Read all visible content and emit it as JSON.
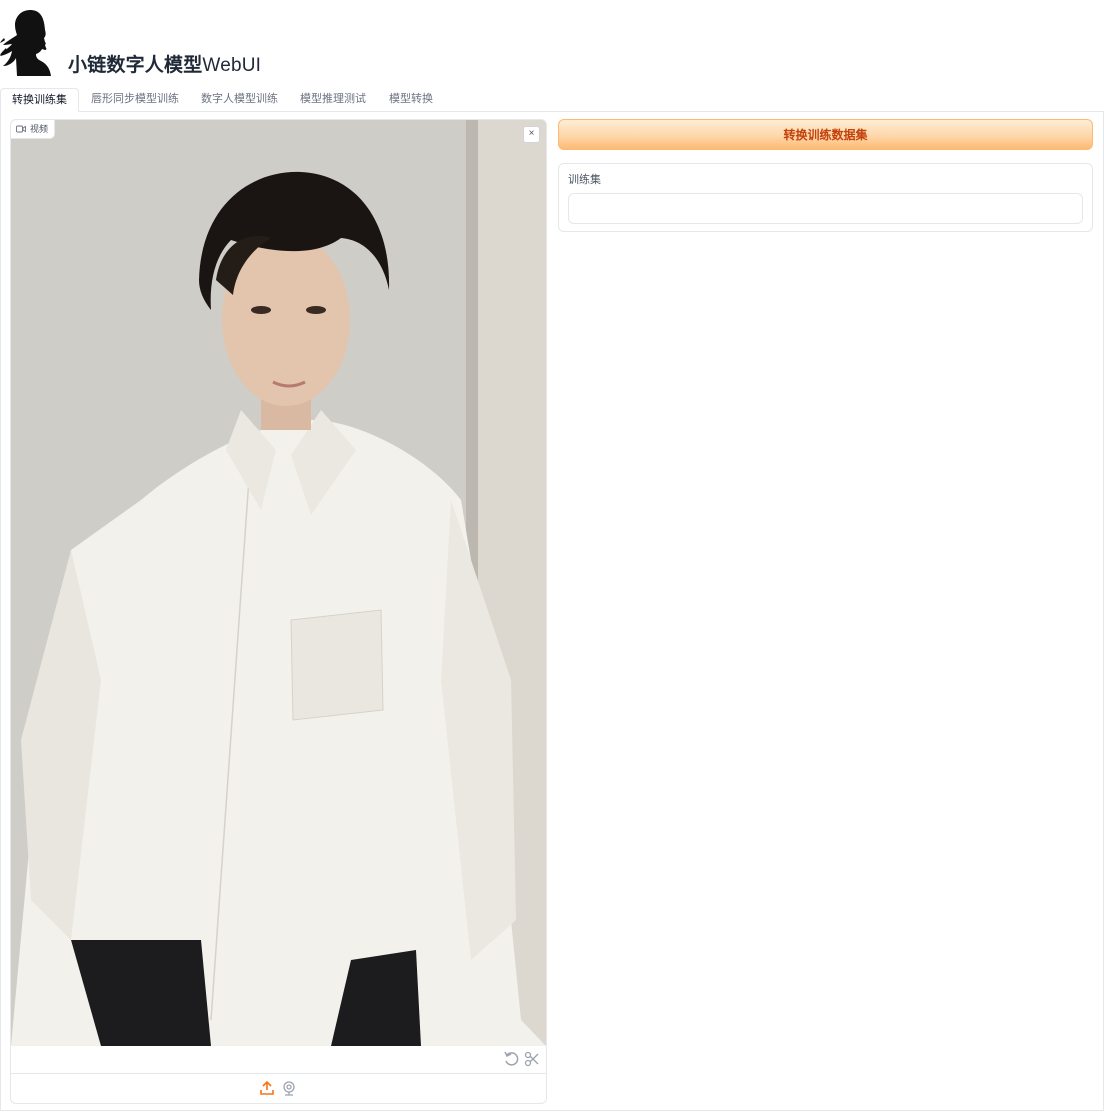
{
  "app": {
    "title_cn": "小链数字人模型",
    "title_en": "WebUI",
    "logo_icon": "woman-silhouette-icon"
  },
  "tabs": [
    {
      "label": "转换训练集",
      "selected": true
    },
    {
      "label": "唇形同步模型训练",
      "selected": false
    },
    {
      "label": "数字人模型训练",
      "selected": false
    },
    {
      "label": "模型推理测试",
      "selected": false
    },
    {
      "label": "模型转换",
      "selected": false
    }
  ],
  "video": {
    "label": "视频",
    "label_icon": "video-camera-icon",
    "clear_icon": "close-icon",
    "clear_symbol": "×",
    "edit_tools": [
      "undo-icon",
      "scissors-icon"
    ],
    "sources": [
      "upload-icon",
      "webcam-icon"
    ]
  },
  "actions": {
    "convert_label": "转换训练数据集"
  },
  "dataset": {
    "label": "训练集",
    "value": ""
  },
  "colors": {
    "accent": "#fdba74",
    "accent_text": "#c2410c",
    "upload_icon": "#f97316"
  }
}
